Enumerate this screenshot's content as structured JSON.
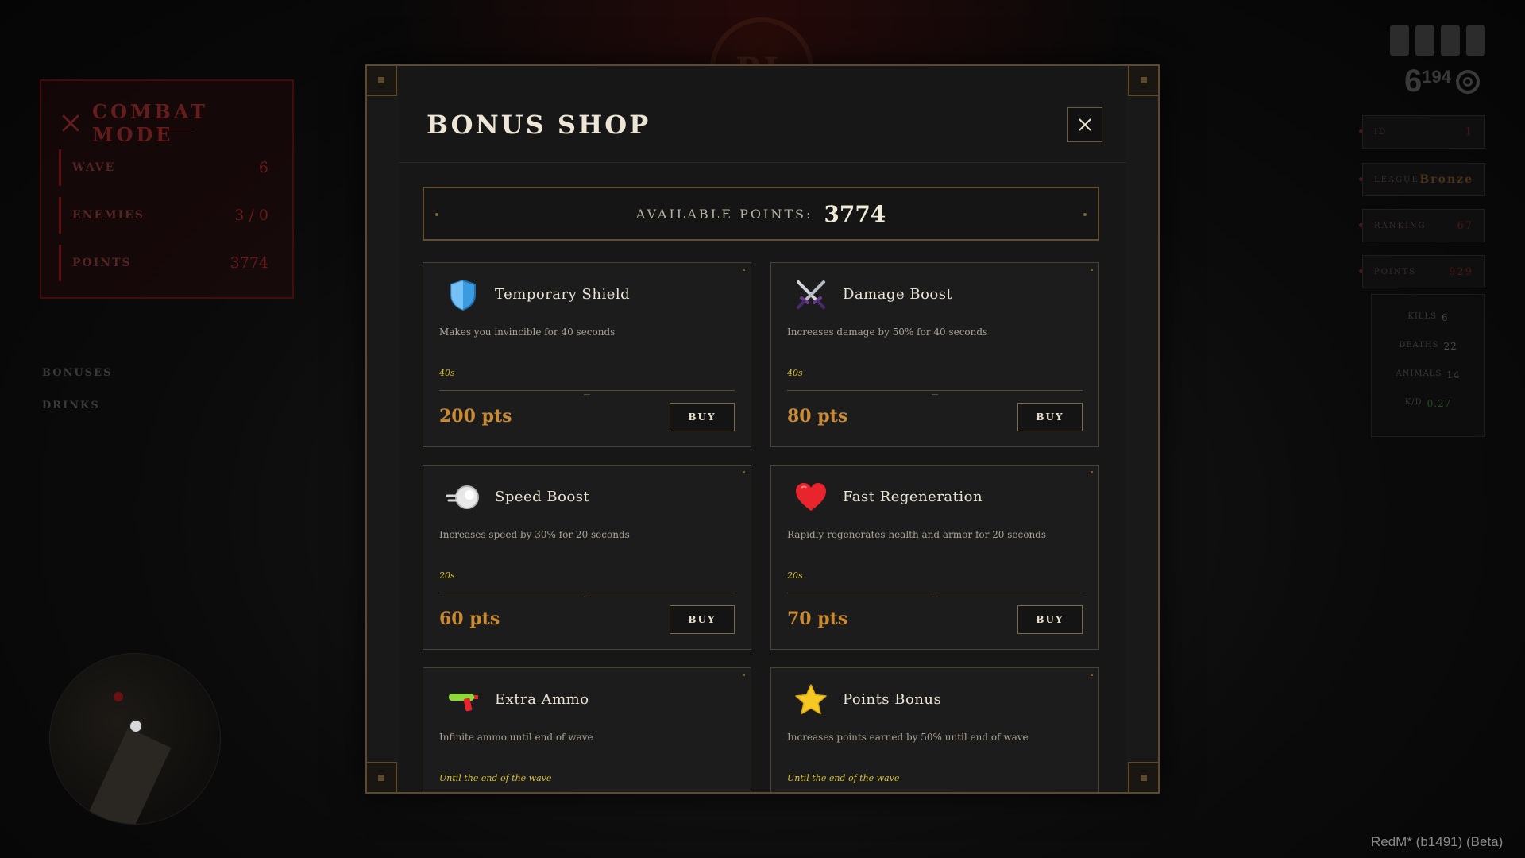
{
  "hud": {
    "combat": {
      "title": "COMBAT MODE",
      "rows": [
        {
          "label": "WAVE",
          "value": "6"
        },
        {
          "label": "ENEMIES",
          "value": "3 / 0"
        },
        {
          "label": "POINTS",
          "value": "3774"
        }
      ]
    },
    "menu": [
      "BONUSES",
      "DRINKS"
    ],
    "right": {
      "money_major": "6",
      "money_minor": "194",
      "stats": [
        {
          "label": "ID",
          "value": "1"
        },
        {
          "label": "LEAGUE",
          "value": "Bronze"
        },
        {
          "label": "RANKING",
          "value": "67"
        },
        {
          "label": "POINTS",
          "value": "929"
        }
      ],
      "details": [
        {
          "label": "KILLS",
          "value": "6"
        },
        {
          "label": "DEATHS",
          "value": "22"
        },
        {
          "label": "ANIMALS",
          "value": "14"
        },
        {
          "label": "K/D",
          "value": "0.27"
        }
      ]
    },
    "footer": "RedM* (b1491) (Beta)"
  },
  "shop": {
    "title": "BONUS SHOP",
    "points_label": "AVAILABLE POINTS:",
    "points_value": "3774",
    "buy_label": "BUY",
    "items": [
      {
        "name": "Temporary Shield",
        "description": "Makes you invincible for 40 seconds",
        "duration": "40s",
        "price": "200 pts",
        "icon": "shield-icon"
      },
      {
        "name": "Damage Boost",
        "description": "Increases damage by 50% for 40 seconds",
        "duration": "40s",
        "price": "80 pts",
        "icon": "crossed-swords-icon"
      },
      {
        "name": "Speed Boost",
        "description": "Increases speed by 30% for 20 seconds",
        "duration": "20s",
        "price": "60 pts",
        "icon": "wind-icon"
      },
      {
        "name": "Fast Regeneration",
        "description": "Rapidly regenerates health and armor for 20 seconds",
        "duration": "20s",
        "price": "70 pts",
        "icon": "heart-icon"
      },
      {
        "name": "Extra Ammo",
        "description": "Infinite ammo until end of wave",
        "duration": "Until the end of the wave",
        "price": "",
        "icon": "water-gun-icon"
      },
      {
        "name": "Points Bonus",
        "description": "Increases points earned by 50% until end of wave",
        "duration": "Until the end of the wave",
        "price": "",
        "icon": "star-icon"
      }
    ]
  },
  "colors": {
    "accent_gold": "#5b4a2e",
    "price_orange": "#c98a33",
    "duration_yellow": "#d8c43a",
    "scroll_green": "#2e7a3a"
  }
}
